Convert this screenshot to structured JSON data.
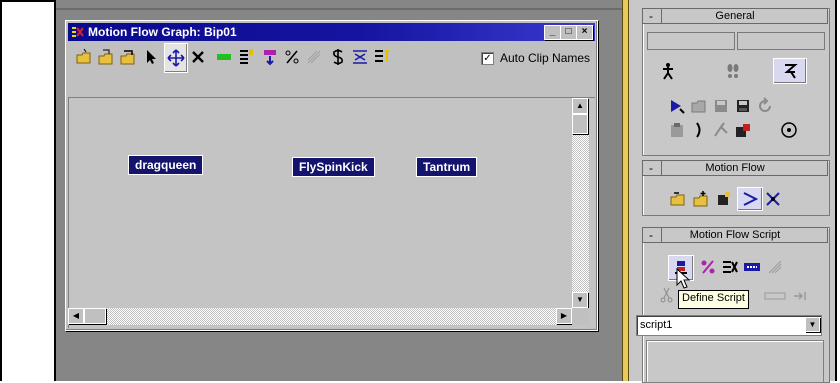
{
  "window": {
    "title": "Motion Flow Graph: Bip01",
    "controls": [
      "_",
      "□",
      "×"
    ]
  },
  "toolbar": {
    "icons": [
      "new-icon",
      "open-icon",
      "save-icon",
      "select-arrow-icon",
      "move-icon",
      "delete-icon",
      "clip-icon",
      "transition-icon",
      "marker-icon",
      "percent-icon",
      "randomize-icon",
      "dollar-icon",
      "optimize-icon",
      "info-icon"
    ],
    "auto_clip_names_label": "Auto Clip Names",
    "auto_clip_names_checked": true
  },
  "graph": {
    "clips": [
      "dragqueen",
      "FlySpinKick",
      "Tantrum"
    ]
  },
  "panel": {
    "general_title": "General",
    "motion_flow_title": "Motion Flow",
    "motion_flow_script_title": "Motion Flow Script",
    "tooltip": "Define Script",
    "script_select_value": "script1"
  },
  "colors": {
    "titlebar": "#0a0a8e",
    "clip_bg": "#14146e",
    "separator": "#e9c95a",
    "tooltip_bg": "#ffffe1"
  }
}
